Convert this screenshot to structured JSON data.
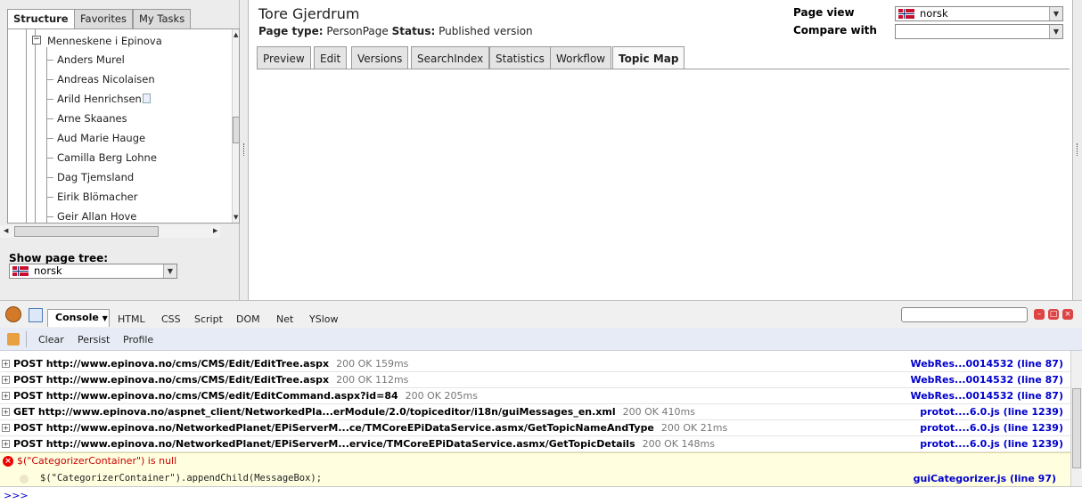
{
  "left_tabs": [
    "Structure",
    "Favorites",
    "My Tasks"
  ],
  "tree": {
    "parent": "Menneskene i Epinova",
    "children": [
      "Anders Murel",
      "Andreas Nicolaisen",
      "Arild Henrichsen",
      "Arne Skaanes",
      "Aud Marie Hauge",
      "Camilla Berg Lohne",
      "Dag Tjemsland",
      "Eirik Blömacher",
      "Geir Allan Hove"
    ]
  },
  "show_tree": {
    "label": "Show page tree:",
    "value": "norsk"
  },
  "page": {
    "title": "Tore Gjerdrum",
    "type_label": "Page type:",
    "type_value": "PersonPage",
    "status_label": "Status:",
    "status_value": "Published version"
  },
  "page_view": {
    "label": "Page view",
    "value": "norsk",
    "compare_label": "Compare with",
    "compare_value": ""
  },
  "main_tabs": [
    "Preview",
    "Edit",
    "Versions",
    "SearchIndex",
    "Statistics",
    "Workflow",
    "Topic Map"
  ],
  "firebug": {
    "tabs": [
      "Console",
      "HTML",
      "CSS",
      "Script",
      "DOM",
      "Net",
      "YSlow"
    ],
    "sub": [
      "Clear",
      "Persist",
      "Profile"
    ],
    "requests": [
      {
        "method": "POST",
        "url": "http://www.epinova.no/cms/CMS/Edit/EditTree.aspx",
        "status": "200 OK 159ms",
        "source": "WebRes...0014532 (line 87)"
      },
      {
        "method": "POST",
        "url": "http://www.epinova.no/cms/CMS/Edit/EditTree.aspx",
        "status": "200 OK 112ms",
        "source": "WebRes...0014532 (line 87)"
      },
      {
        "method": "POST",
        "url": "http://www.epinova.no/cms/CMS/edit/EditCommand.aspx?id=84",
        "status": "200 OK 205ms",
        "source": "WebRes...0014532 (line 87)"
      },
      {
        "method": "GET",
        "url": "http://www.epinova.no/aspnet_client/NetworkedPla...erModule/2.0/topiceditor/i18n/guiMessages_en.xml",
        "status": "200 OK 410ms",
        "source": "protot....6.0.js (line 1239)"
      },
      {
        "method": "POST",
        "url": "http://www.epinova.no/NetworkedPlanet/EPiServerM...ce/TMCoreEPiDataService.asmx/GetTopicNameAndType",
        "status": "200 OK 21ms",
        "source": "protot....6.0.js (line 1239)"
      },
      {
        "method": "POST",
        "url": "http://www.epinova.no/NetworkedPlanet/EPiServerM...ervice/TMCoreEPiDataService.asmx/GetTopicDetails",
        "status": "200 OK 148ms",
        "source": "protot....6.0.js (line 1239)"
      }
    ],
    "error": {
      "message": "$(\"CategorizerContainer\") is null",
      "code": "$(\"CategorizerContainer\").appendChild(MessageBox);",
      "source": "guiCategorizer.js (line 97)"
    },
    "prompt": ">>>"
  }
}
